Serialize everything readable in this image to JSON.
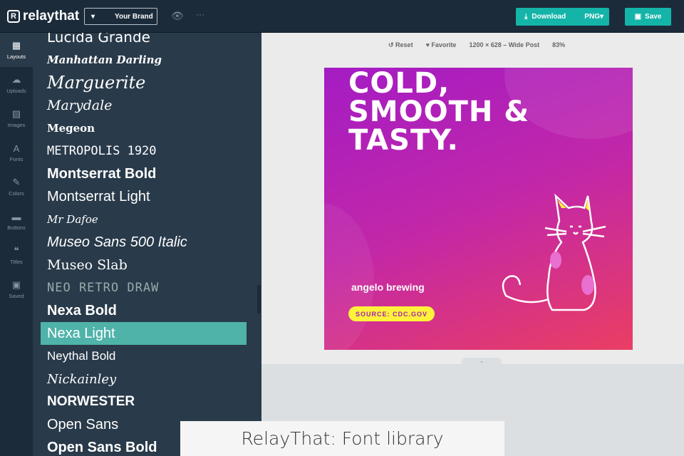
{
  "header": {
    "logo": "relaythat",
    "brand_select": "Your Brand",
    "download_label": "Download",
    "format": "PNG",
    "save_label": "Save"
  },
  "rail": [
    {
      "label": "Layouts",
      "icon": "layout-icon"
    },
    {
      "label": "Uploads",
      "icon": "cloud-upload-icon"
    },
    {
      "label": "Images",
      "icon": "image-icon"
    },
    {
      "label": "Fonts",
      "icon": "font-icon"
    },
    {
      "label": "Colors",
      "icon": "brush-icon"
    },
    {
      "label": "Buttons",
      "icon": "button-icon"
    },
    {
      "label": "Titles",
      "icon": "quote-icon"
    },
    {
      "label": "Saved",
      "icon": "floppy-icon"
    }
  ],
  "fonts": [
    "Lucida Grande",
    "Manhattan Darling",
    "Marguerite",
    "Marydale",
    "Megeon",
    "METROPOLIS 1920",
    "Montserrat Bold",
    "Montserrat Light",
    "Mr Dafoe",
    "Museo Sans 500 Italic",
    "Museo Slab",
    "NEO RETRO DRAW",
    "Nexa Bold",
    "Nexa Light",
    "Neythal Bold",
    "Nickainley",
    "NORWESTER",
    "Open Sans",
    "Open Sans Bold"
  ],
  "selected_font": "Nexa Light",
  "toolbar": {
    "reset": "Reset",
    "favorite": "Favorite",
    "size": "1200 × 628 – Wide Post",
    "zoom": "83%"
  },
  "design": {
    "headline1": "COLD,",
    "headline2": "SMOOTH &",
    "headline3": "TASTY.",
    "brand": "angelo brewing",
    "source": "SOURCE: CDC.GOV"
  },
  "caption": "RelayThat: Font library",
  "colors": {
    "accent": "#14b4a8",
    "topbar": "#1c2b3a",
    "panel": "#293a4a",
    "selected": "#4fb3aa"
  }
}
